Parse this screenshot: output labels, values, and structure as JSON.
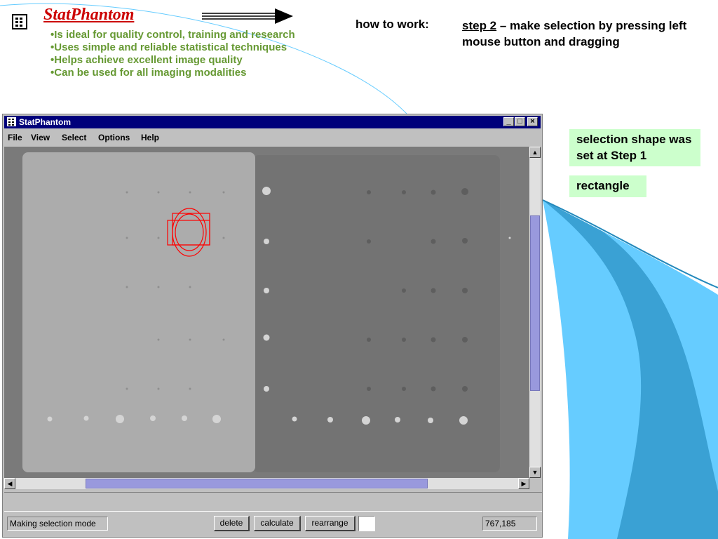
{
  "slide": {
    "title": "StatPhantom",
    "bullets": [
      "Is ideal for quality control, training and research",
      "Uses simple and reliable statistical techniques",
      "Helps achieve excellent image quality",
      "Can be used for all imaging modalities"
    ],
    "how_label": "how to work:",
    "step_label": "step 2",
    "step_text": " – make selection by pressing left mouse button and dragging",
    "note_shape": "selection shape was set at Step 1",
    "note_shape_value": "rectangle",
    "colors": {
      "title": "#cc0000",
      "bullets": "#669933",
      "note_bg": "#ccffcc",
      "accent_blue": "#66ccff"
    }
  },
  "window": {
    "title": "StatPhantom",
    "controls": {
      "minimize": "_",
      "maximize": "□",
      "close": "×"
    },
    "menu": [
      "File",
      "View",
      "Select",
      "Options",
      "Help"
    ],
    "status_text": "Making selection mode",
    "buttons": {
      "delete": "delete",
      "calculate": "calculate",
      "rearrange": "rearrange"
    },
    "coordinates": "767,185",
    "selection_color": "#ff0000"
  }
}
